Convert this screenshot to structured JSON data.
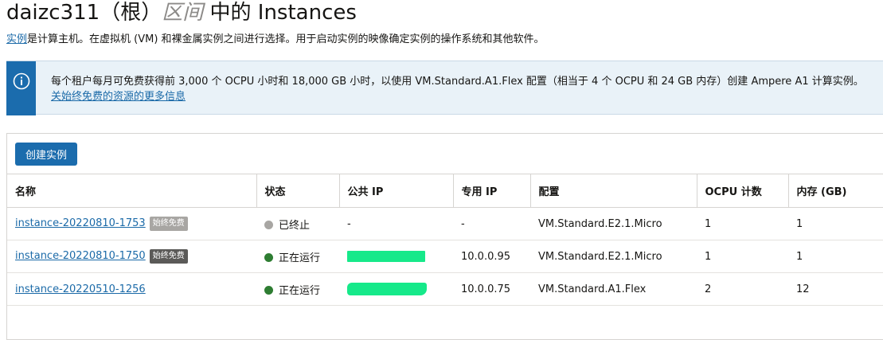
{
  "header": {
    "title_prefix": "daizc311（根）",
    "title_compartment": "区间",
    "title_suffix": " 中的 Instances",
    "desc_link": "实例",
    "desc_text": "是计算主机。在虚拟机 (VM) 和裸金属实例之间进行选择。用于启动实例的映像确定实例的操作系统和其他软件。"
  },
  "banner": {
    "icon": "info-icon",
    "message": "每个租户每月可免费获得前 3,000 个 OCPU 小时和 18,000 GB 小时，以使用 VM.Standard.A1.Flex 配置（相当于 4 个 OCPU 和 24 GB 内存）创建 Ampere A1 计算实例。",
    "link": "关始终免费的资源的更多信息",
    "accent": "#1b6cad",
    "background": "#e9f2f8"
  },
  "toolbar": {
    "create_label": "创建实例"
  },
  "table": {
    "columns": [
      "名称",
      "状态",
      "公共 IP",
      "专用 IP",
      "配置",
      "OCPU 计数",
      "内存 (GB)"
    ],
    "rows": [
      {
        "name": "instance-20220810-1753",
        "badge": "始终免费",
        "badge_color": "#a8a6a3",
        "status": "已终止",
        "status_color": "#a8a6a3",
        "public_ip": "-",
        "public_ip_redacted": false,
        "private_ip": "-",
        "shape": "VM.Standard.E2.1.Micro",
        "ocpu": "1",
        "memory": "1"
      },
      {
        "name": "instance-20220810-1750",
        "badge": "始终免费",
        "badge_color": "#5b5a58",
        "status": "正在运行",
        "status_color": "#2e7d32",
        "public_ip": "",
        "public_ip_redacted": true,
        "private_ip": "10.0.0.95",
        "shape": "VM.Standard.E2.1.Micro",
        "ocpu": "1",
        "memory": "1"
      },
      {
        "name": "instance-20220510-1256",
        "badge": "",
        "badge_color": "",
        "status": "正在运行",
        "status_color": "#2e7d32",
        "public_ip": "",
        "public_ip_redacted": true,
        "private_ip": "10.0.0.75",
        "shape": "VM.Standard.A1.Flex",
        "ocpu": "2",
        "memory": "12"
      }
    ]
  }
}
